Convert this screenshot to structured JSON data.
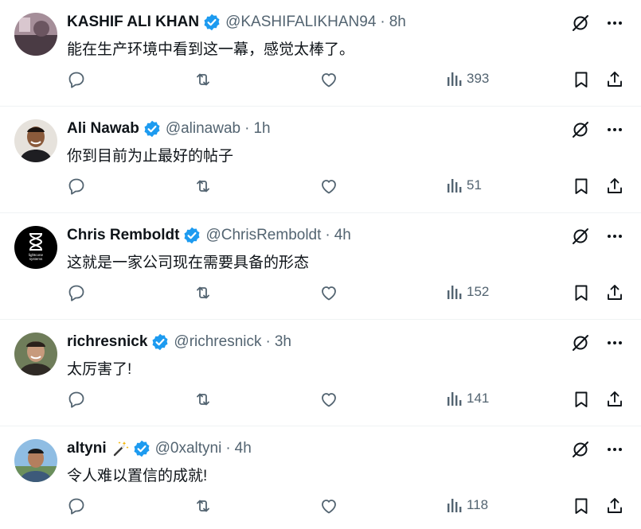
{
  "tweets": [
    {
      "name": "KASHIF ALI KHAN",
      "handle": "@KASHIFALIKHAN94",
      "dot": "·",
      "time": "8h",
      "text": "能在生产环境中看到这一幕，感觉太棒了。",
      "views": "393",
      "avatar_colors": [
        "#b59aa5",
        "#4a3b44"
      ]
    },
    {
      "name": "Ali Nawab",
      "handle": "@alinawab",
      "dot": "·",
      "time": "1h",
      "text": "你到目前为止最好的帖子",
      "views": "51",
      "avatar_colors": [
        "#e4e0dc",
        "#6b4a33"
      ]
    },
    {
      "name": "Chris Remboldt",
      "handle": "@ChrisRemboldt",
      "dot": "·",
      "time": "4h",
      "text": "这就是一家公司现在需要具备的形态",
      "views": "152",
      "avatar_colors": [
        "#000000",
        "#ffffff"
      ],
      "avatar_caption_1": "lightcone",
      "avatar_caption_2": "systems"
    },
    {
      "name": "richresnick",
      "handle": "@richresnick",
      "dot": "·",
      "time": "3h",
      "text": "太厉害了!",
      "views": "141",
      "avatar_colors": [
        "#6f7d5a",
        "#2f2a25"
      ]
    },
    {
      "name": "altyni",
      "name_emoji": "magic-wand-icon",
      "handle": "@0xaltyni",
      "dot": "·",
      "time": "4h",
      "text": "令人难以置信的成就!",
      "views": "118",
      "avatar_colors": [
        "#7fb1dc",
        "#3d5a7a"
      ]
    }
  ],
  "icons": {
    "verified": "verified-badge-icon",
    "grok": "grok-icon",
    "more": "more-icon",
    "reply": "reply-icon",
    "retweet": "retweet-icon",
    "like": "like-icon",
    "views": "views-icon",
    "bookmark": "bookmark-icon",
    "share": "share-icon"
  },
  "colors": {
    "verified": "#1d9bf0",
    "text": "#0f1419",
    "muted": "#536471",
    "border": "#eff3f4"
  }
}
